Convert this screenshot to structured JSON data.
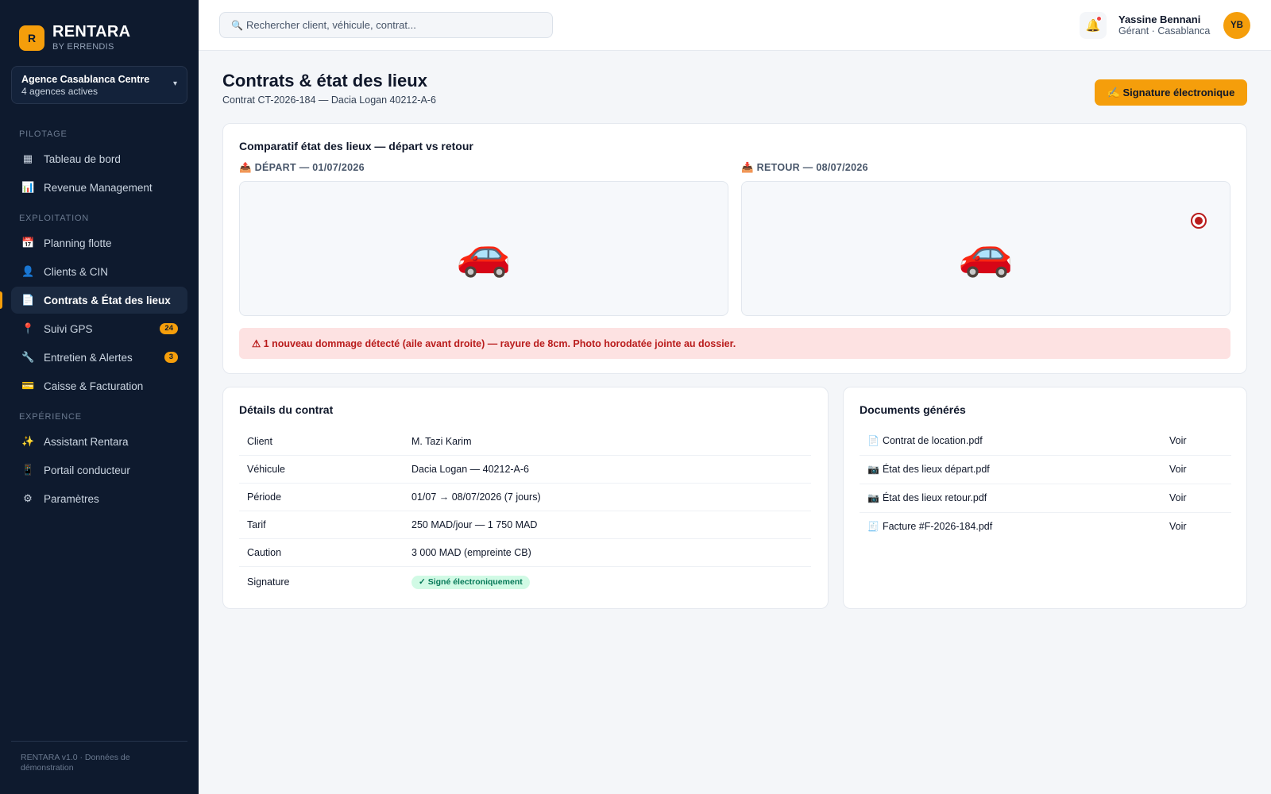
{
  "brand": {
    "logo_letter": "R",
    "name": "RENTARA",
    "sub": "BY ERRENDIS"
  },
  "agency": {
    "name": "Agence Casablanca Centre",
    "sub": "4 agences actives",
    "caret": "▾"
  },
  "nav": {
    "sections": [
      "PILOTAGE",
      "EXPLOITATION",
      "EXPÉRIENCE"
    ],
    "items": [
      {
        "icon": "▦",
        "icon_name": "dashboard-icon",
        "label": "Tableau de bord"
      },
      {
        "icon": "📊",
        "icon_name": "chart-icon",
        "label": "Revenue Management"
      },
      {
        "icon": "📅",
        "icon_name": "calendar-icon",
        "label": "Planning flotte"
      },
      {
        "icon": "👤",
        "icon_name": "user-icon",
        "label": "Clients & CIN"
      },
      {
        "icon": "📄",
        "icon_name": "document-icon",
        "label": "Contrats & État des lieux"
      },
      {
        "icon": "📍",
        "icon_name": "pin-icon",
        "label": "Suivi GPS",
        "badge": "24"
      },
      {
        "icon": "🔧",
        "icon_name": "wrench-icon",
        "label": "Entretien & Alertes",
        "badge": "3"
      },
      {
        "icon": "💳",
        "icon_name": "card-icon",
        "label": "Caisse & Facturation"
      },
      {
        "icon": "✨",
        "icon_name": "sparkles-icon",
        "label": "Assistant Rentara"
      },
      {
        "icon": "📱",
        "icon_name": "phone-icon",
        "label": "Portail conducteur"
      },
      {
        "icon": "⚙",
        "icon_name": "gear-icon",
        "label": "Paramètres"
      }
    ],
    "active_label": "Contrats & État des lieux"
  },
  "footer": {
    "text": "RENTARA v1.0 · Données de démonstration"
  },
  "topbar": {
    "search_placeholder": "Rechercher client, véhicule, contrat...",
    "search_icon": "🔍",
    "bell_icon": "🔔",
    "user_name": "Yassine Bennani",
    "user_role": "Gérant · Casablanca",
    "avatar_initials": "YB"
  },
  "page": {
    "title": "Contrats & état des lieux",
    "subtitle": "Contrat CT-2026-184 — Dacia Logan 40212-A-6",
    "sign_button": "✍ Signature électronique"
  },
  "comparison": {
    "title": "Comparatif état des lieux — départ vs retour",
    "depart_icon": "📤",
    "depart_label": "DÉPART — 01/07/2026",
    "retour_icon": "📥",
    "retour_label": "RETOUR — 08/07/2026",
    "car_glyph": "🚗",
    "alert": "⚠ 1 nouveau dommage détecté (aile avant droite) — rayure de 8cm. Photo horodatée jointe au dossier."
  },
  "contract": {
    "title": "Détails du contrat",
    "rows": [
      {
        "key": "Client",
        "value": "M. Tazi Karim"
      },
      {
        "key": "Véhicule",
        "value": "Dacia Logan — 40212-A-6"
      },
      {
        "key": "Période",
        "value": "01/07 → 08/07/2026 (7 jours)"
      },
      {
        "key": "Tarif",
        "value": "250 MAD/jour — 1 750 MAD"
      },
      {
        "key": "Caution",
        "value": "3 000 MAD (empreinte CB)"
      },
      {
        "key": "Signature",
        "value": "✓ Signé électroniquement"
      }
    ]
  },
  "documents": {
    "title": "Documents générés",
    "items": [
      {
        "icon": "📄",
        "name": "Contrat de location.pdf",
        "action": "Voir"
      },
      {
        "icon": "📷",
        "name": "État des lieux départ.pdf",
        "action": "Voir"
      },
      {
        "icon": "📷",
        "name": "État des lieux retour.pdf",
        "action": "Voir"
      },
      {
        "icon": "🧾",
        "name": "Facture #F-2026-184.pdf",
        "action": "Voir"
      }
    ]
  },
  "colors": {
    "accent": "#f59e0b",
    "sidebar_bg": "#0e1a2e",
    "danger": "#b91c1c",
    "success": "#047857"
  }
}
